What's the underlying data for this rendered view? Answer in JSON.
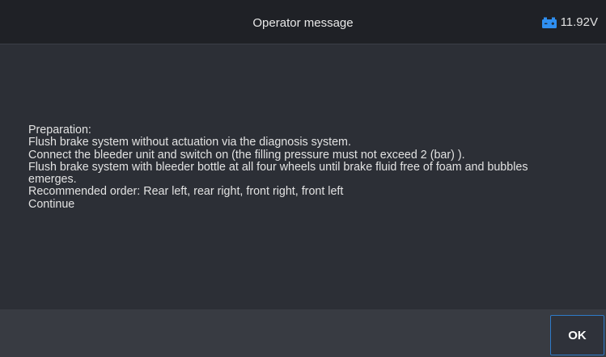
{
  "header": {
    "title": "Operator message",
    "battery": {
      "icon": "car-battery-icon",
      "icon_color": "#2f8ff0",
      "voltage": "11.92V"
    }
  },
  "message": {
    "lines": [
      "Preparation:",
      "Flush brake system without actuation via the diagnosis system.",
      "Connect the bleeder unit and switch on (the filling pressure must not exceed 2  (bar) ).",
      "Flush brake system with bleeder bottle at all four wheels until brake fluid free of foam and bubbles",
      "emerges.",
      "Recommended order: Rear left, rear right, front right, front left",
      "Continue"
    ]
  },
  "footer": {
    "ok_label": "OK",
    "accent_color": "#2f7ac8"
  }
}
